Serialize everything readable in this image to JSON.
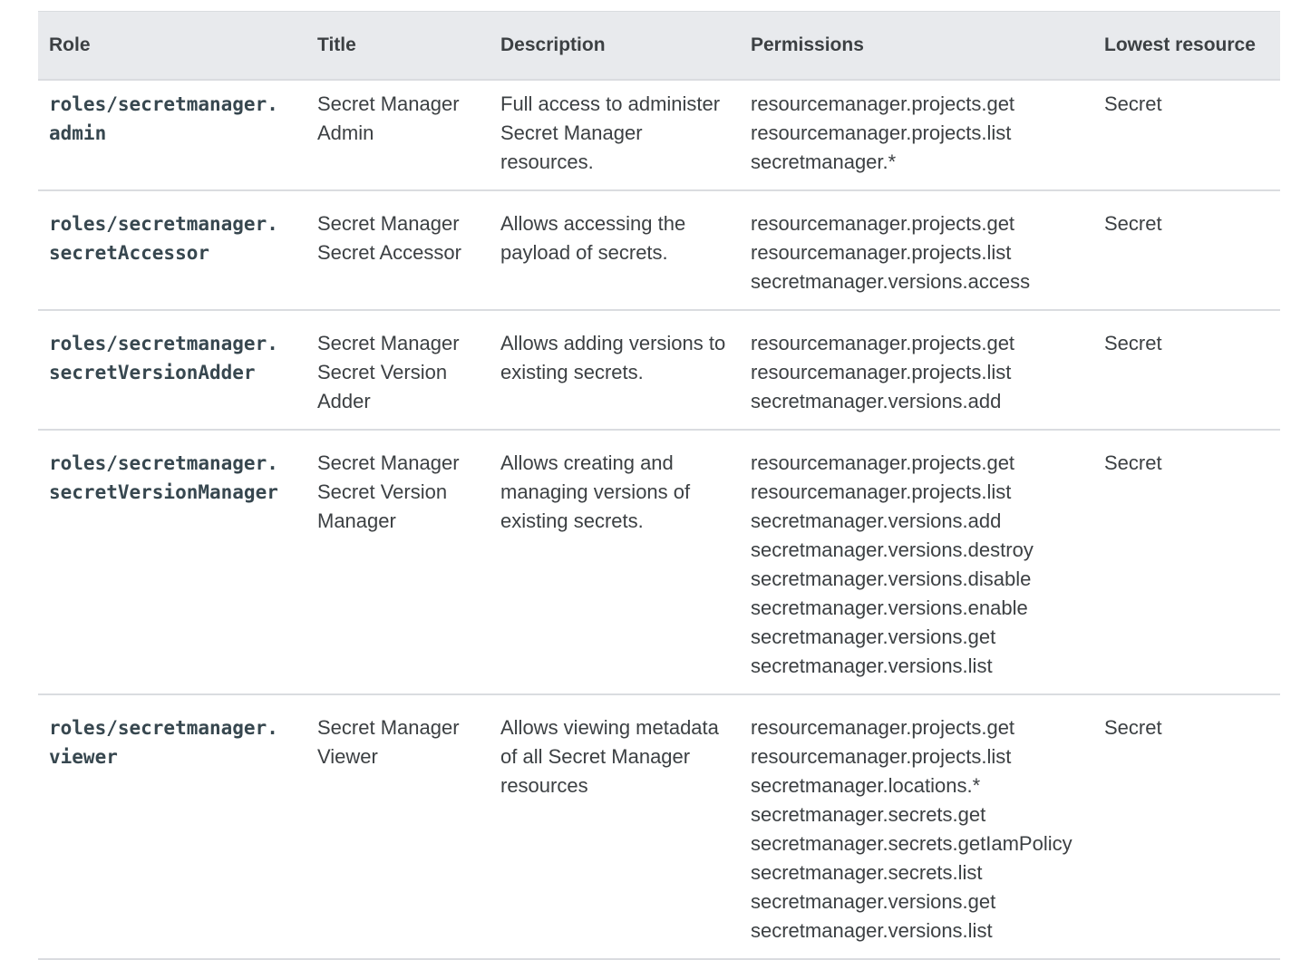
{
  "table": {
    "headers": {
      "role": "Role",
      "title": "Title",
      "description": "Description",
      "permissions": "Permissions",
      "lowest_resource": "Lowest resource"
    },
    "rows": [
      {
        "role_line1": "roles/secretmanager.",
        "role_line2": "admin",
        "title": "Secret Manager Admin",
        "description": "Full access to administer Secret Manager resources.",
        "permissions": [
          "resourcemanager.projects.get",
          "resourcemanager.projects.list",
          "secretmanager.*"
        ],
        "lowest_resource": "Secret"
      },
      {
        "role_line1": "roles/secretmanager.",
        "role_line2": "secretAccessor",
        "title": "Secret Manager Secret Accessor",
        "description": "Allows accessing the payload of secrets.",
        "permissions": [
          "resourcemanager.projects.get",
          "resourcemanager.projects.list",
          "secretmanager.versions.access"
        ],
        "lowest_resource": "Secret"
      },
      {
        "role_line1": "roles/secretmanager.",
        "role_line2": "secretVersionAdder",
        "title": "Secret Manager Secret Version Adder",
        "description": "Allows adding versions to existing secrets.",
        "permissions": [
          "resourcemanager.projects.get",
          "resourcemanager.projects.list",
          "secretmanager.versions.add"
        ],
        "lowest_resource": "Secret"
      },
      {
        "role_line1": "roles/secretmanager.",
        "role_line2": "secretVersionManager",
        "title": "Secret Manager Secret Version Manager",
        "description": "Allows creating and managing versions of existing secrets.",
        "permissions": [
          "resourcemanager.projects.get",
          "resourcemanager.projects.list",
          "secretmanager.versions.add",
          "secretmanager.versions.destroy",
          "secretmanager.versions.disable",
          "secretmanager.versions.enable",
          "secretmanager.versions.get",
          "secretmanager.versions.list"
        ],
        "lowest_resource": "Secret"
      },
      {
        "role_line1": "roles/secretmanager.",
        "role_line2": "viewer",
        "title": "Secret Manager Viewer",
        "description": "Allows viewing metadata of all Secret Manager resources",
        "permissions": [
          "resourcemanager.projects.get",
          "resourcemanager.projects.list",
          "secretmanager.locations.*",
          "secretmanager.secrets.get",
          "secretmanager.secrets.getIamPolicy",
          "secretmanager.secrets.list",
          "secretmanager.versions.get",
          "secretmanager.versions.list"
        ],
        "lowest_resource": "Secret"
      }
    ]
  }
}
